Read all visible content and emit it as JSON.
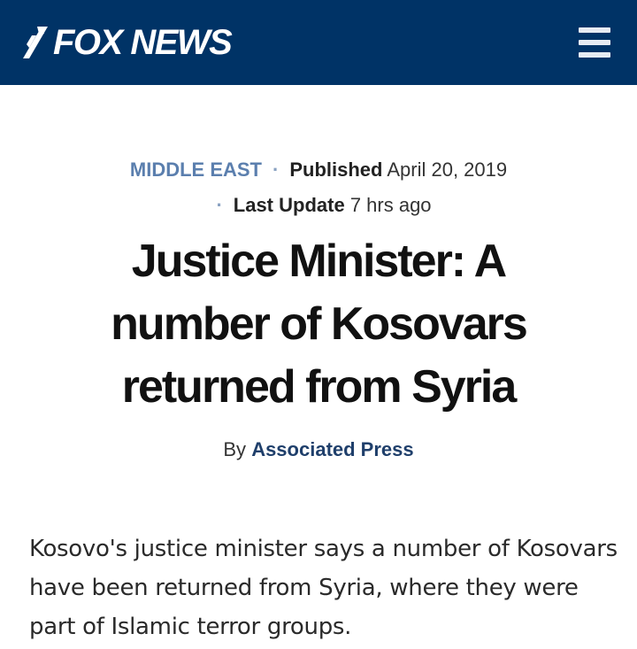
{
  "header": {
    "logo_text": "FOX NEWS",
    "bg_color": "#003366",
    "menu_icon": "hamburger-menu-icon"
  },
  "meta": {
    "category": "MIDDLE EAST",
    "published_label": "Published",
    "published_date": "April 20, 2019",
    "updated_label": "Last Update",
    "updated_value": "7 hrs ago",
    "separator": "·"
  },
  "article": {
    "headline": "Justice Minister: A number of Kosovars returned from Syria",
    "by_label": "By",
    "author": "Associated Press",
    "body": "Kosovo's justice minister says a number of Kosovars have been returned from Syria, where they were part of Islamic terror groups."
  },
  "colors": {
    "category": "#5b7fae",
    "author": "#1f3f6b"
  }
}
